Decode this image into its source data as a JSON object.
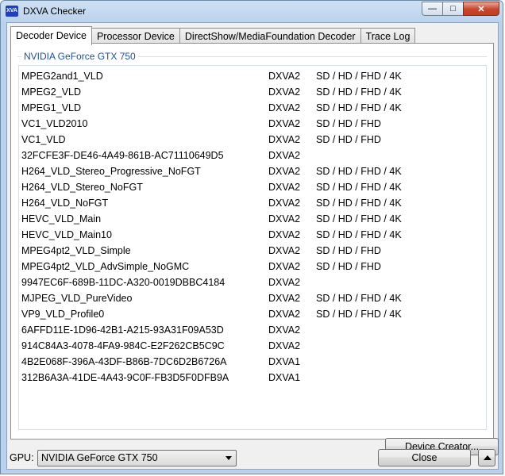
{
  "window": {
    "title": "DXVA Checker",
    "icon_label": "XVA",
    "controls": {
      "minimize": "minimize-icon",
      "maximize": "maximize-icon",
      "close": "close-icon"
    }
  },
  "tabs": [
    {
      "label": "Decoder Device",
      "active": true
    },
    {
      "label": "Processor Device",
      "active": false
    },
    {
      "label": "DirectShow/MediaFoundation Decoder",
      "active": false
    },
    {
      "label": "Trace Log",
      "active": false
    }
  ],
  "group_title": "NVIDIA GeForce GTX 750",
  "decoders": [
    {
      "name": "MPEG2and1_VLD",
      "api": "DXVA2",
      "res": "SD / HD / FHD / 4K"
    },
    {
      "name": "MPEG2_VLD",
      "api": "DXVA2",
      "res": "SD / HD / FHD / 4K"
    },
    {
      "name": "MPEG1_VLD",
      "api": "DXVA2",
      "res": "SD / HD / FHD / 4K"
    },
    {
      "name": "VC1_VLD2010",
      "api": "DXVA2",
      "res": "SD / HD / FHD"
    },
    {
      "name": "VC1_VLD",
      "api": "DXVA2",
      "res": "SD / HD / FHD"
    },
    {
      "name": "32FCFE3F-DE46-4A49-861B-AC71110649D5",
      "api": "DXVA2",
      "res": ""
    },
    {
      "name": "H264_VLD_Stereo_Progressive_NoFGT",
      "api": "DXVA2",
      "res": "SD / HD / FHD / 4K"
    },
    {
      "name": "H264_VLD_Stereo_NoFGT",
      "api": "DXVA2",
      "res": "SD / HD / FHD / 4K"
    },
    {
      "name": "H264_VLD_NoFGT",
      "api": "DXVA2",
      "res": "SD / HD / FHD / 4K"
    },
    {
      "name": "HEVC_VLD_Main",
      "api": "DXVA2",
      "res": "SD / HD / FHD / 4K"
    },
    {
      "name": "HEVC_VLD_Main10",
      "api": "DXVA2",
      "res": "SD / HD / FHD / 4K"
    },
    {
      "name": "MPEG4pt2_VLD_Simple",
      "api": "DXVA2",
      "res": "SD / HD / FHD"
    },
    {
      "name": "MPEG4pt2_VLD_AdvSimple_NoGMC",
      "api": "DXVA2",
      "res": "SD / HD / FHD"
    },
    {
      "name": "9947EC6F-689B-11DC-A320-0019DBBC4184",
      "api": "DXVA2",
      "res": ""
    },
    {
      "name": "MJPEG_VLD_PureVideo",
      "api": "DXVA2",
      "res": "SD / HD / FHD / 4K"
    },
    {
      "name": "VP9_VLD_Profile0",
      "api": "DXVA2",
      "res": "SD / HD / FHD / 4K"
    },
    {
      "name": "6AFFD11E-1D96-42B1-A215-93A31F09A53D",
      "api": "DXVA2",
      "res": ""
    },
    {
      "name": "914C84A3-4078-4FA9-984C-E2F262CB5C9C",
      "api": "DXVA2",
      "res": ""
    },
    {
      "name": "4B2E068F-396A-43DF-B86B-7DC6D2B6726A",
      "api": "DXVA1",
      "res": ""
    },
    {
      "name": "312B6A3A-41DE-4A43-9C0F-FB3D5F0DFB9A",
      "api": "DXVA1",
      "res": ""
    }
  ],
  "buttons": {
    "device_creator": "Device Creator...",
    "close": "Close",
    "up": "up-arrow-icon"
  },
  "gpu": {
    "label": "GPU:",
    "selected": "NVIDIA GeForce GTX 750"
  }
}
